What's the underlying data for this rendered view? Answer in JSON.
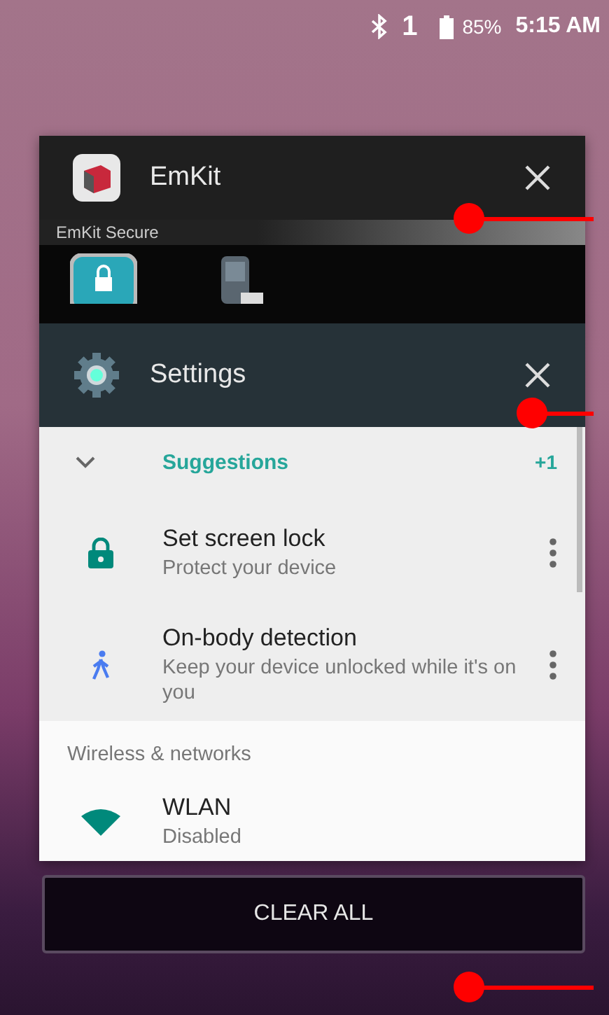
{
  "status_bar": {
    "sim_number": "1",
    "battery": "85%",
    "time": "5:15 AM"
  },
  "emkit_card": {
    "title": "EmKit",
    "preview_label": "EmKit Secure"
  },
  "settings_card": {
    "title": "Settings",
    "suggestions": {
      "label": "Suggestions",
      "count": "+1"
    },
    "suggestion_items": [
      {
        "kind": "lock",
        "title": "Set screen lock",
        "subtitle": "Protect your device"
      },
      {
        "kind": "walk",
        "title": "On-body detection",
        "subtitle": "Keep your device unlocked while it's on you"
      }
    ],
    "section_header": "Wireless & networks",
    "network_items": [
      {
        "kind": "wifi",
        "title": "WLAN",
        "subtitle": "Disabled"
      }
    ]
  },
  "clear_all_button": "CLEAR ALL"
}
